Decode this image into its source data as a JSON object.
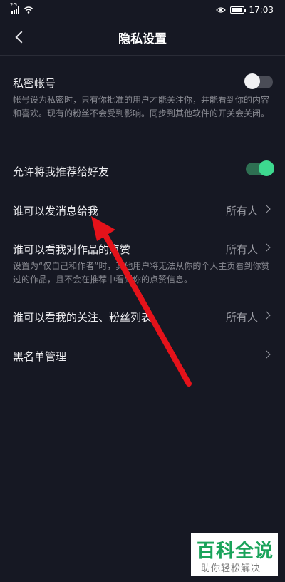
{
  "status_bar": {
    "network_tag": "2G",
    "time": "17:03"
  },
  "nav": {
    "title": "隐私设置"
  },
  "private_account": {
    "label": "私密帐号",
    "description": "帐号设为私密时，只有你批准的用户才能关注你，并能看到你的内容和喜欢。现有的粉丝不会受到影响。同步到其他软件的开关会关闭。",
    "enabled": false
  },
  "recommend_to_friends": {
    "label": "允许将我推荐给好友",
    "enabled": true
  },
  "who_can_message": {
    "label": "谁可以发消息给我",
    "value": "所有人"
  },
  "who_can_see_likes": {
    "label": "谁可以看我对作品的点赞",
    "value": "所有人",
    "description": "设置为“仅自己和作者”时，其他用户将无法从你的个人主页看到你赞过的作品，且不会在推荐中看到你的点赞信息。"
  },
  "who_can_see_follow": {
    "label": "谁可以看我的关注、粉丝列表",
    "value": "所有人"
  },
  "blacklist": {
    "label": "黑名单管理"
  },
  "colors": {
    "background": "#161823",
    "toggle_on": "#3dd88f",
    "annotation_arrow": "#e5121a",
    "watermark_green": "#1aa35a"
  },
  "watermark": {
    "title": "百科全说",
    "subtitle": "助你轻松解决"
  }
}
